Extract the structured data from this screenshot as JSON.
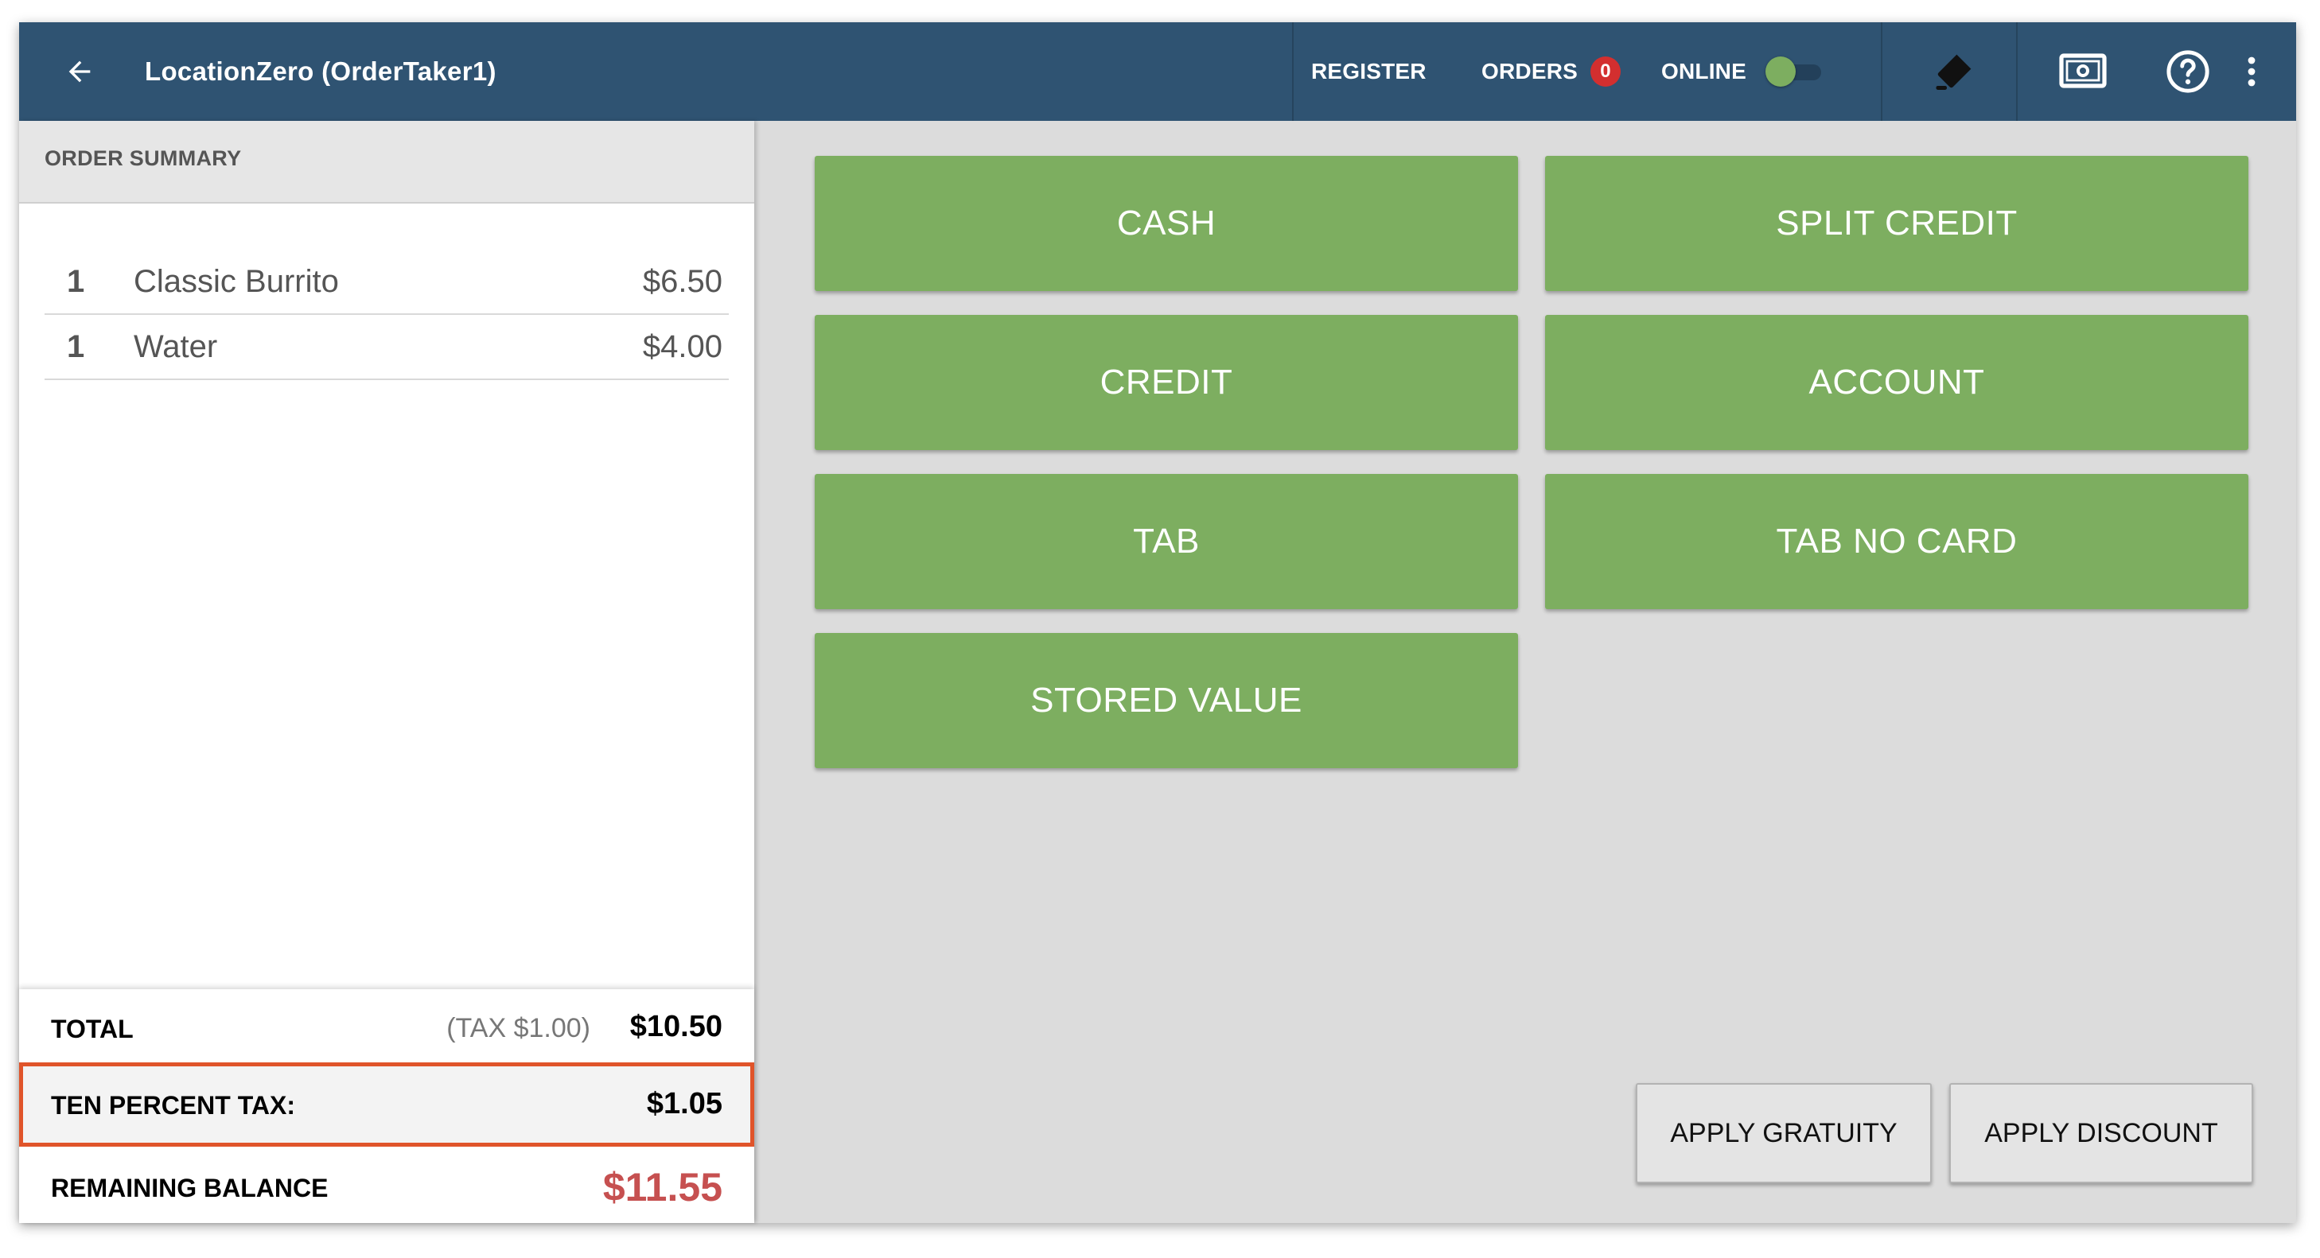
{
  "header": {
    "title": "LocationZero (OrderTaker1)",
    "register_label": "REGISTER",
    "orders_label": "ORDERS",
    "orders_count": "0",
    "online_label": "ONLINE",
    "online_state": "on"
  },
  "icons": {
    "back": "arrow-left-icon",
    "tag": "tag-icon",
    "cash_drawer": "cash-drawer-icon",
    "help": "help-circle-icon",
    "more": "more-vertical-icon"
  },
  "order_summary": {
    "title": "ORDER SUMMARY",
    "items": [
      {
        "qty": "1",
        "name": "Classic Burrito",
        "price": "$6.50"
      },
      {
        "qty": "1",
        "name": "Water",
        "price": "$4.00"
      }
    ]
  },
  "totals": {
    "total_label": "TOTAL",
    "tax_note": "(TAX $1.00)",
    "total_value": "$10.50",
    "ten_percent_tax_label": "TEN PERCENT TAX:",
    "ten_percent_tax_value": "$1.05",
    "remaining_label": "REMAINING BALANCE",
    "remaining_value": "$11.55"
  },
  "payment_methods": {
    "cash": "CASH",
    "split_credit": "SPLIT CREDIT",
    "credit": "CREDIT",
    "account": "ACCOUNT",
    "tab": "TAB",
    "tab_no_card": "TAB NO CARD",
    "stored_value": "STORED VALUE"
  },
  "actions": {
    "apply_gratuity": "APPLY GRATUITY",
    "apply_discount": "APPLY DISCOUNT"
  },
  "colors": {
    "topbar": "#2f5372",
    "pay_button": "#7dae60",
    "badge": "#d32f2f",
    "highlight_border": "#e0542a",
    "remaining_balance": "#c65050"
  }
}
